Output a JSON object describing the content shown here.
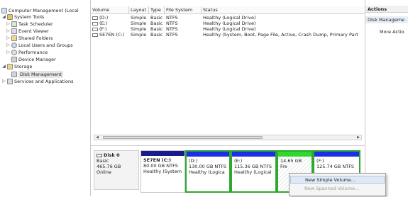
{
  "tree": {
    "items": [
      {
        "label": "Computer Management (Local",
        "toggle": "",
        "icon": "computer-icon"
      },
      {
        "label": "System Tools",
        "toggle": "◢",
        "icon": "tools-icon"
      },
      {
        "label": "Task Scheduler",
        "toggle": "▷",
        "icon": "clock-icon"
      },
      {
        "label": "Event Viewer",
        "toggle": "▷",
        "icon": "event-viewer-icon"
      },
      {
        "label": "Shared Folders",
        "toggle": "▷",
        "icon": "folder-icon"
      },
      {
        "label": "Local Users and Groups",
        "toggle": "▷",
        "icon": "users-icon"
      },
      {
        "label": "Performance",
        "toggle": "▷",
        "icon": "performance-icon"
      },
      {
        "label": "Device Manager",
        "toggle": "",
        "icon": "device-manager-icon"
      },
      {
        "label": "Storage",
        "toggle": "◢",
        "icon": "storage-icon"
      },
      {
        "label": "Disk Management",
        "toggle": "",
        "icon": "disk-management-icon"
      },
      {
        "label": "Services and Applications",
        "toggle": "▷",
        "icon": "services-icon"
      }
    ]
  },
  "volume_list": {
    "columns": [
      "Volume",
      "Layout",
      "Type",
      "File System",
      "Status"
    ],
    "rows": [
      {
        "volume": "(D:)",
        "layout": "Simple",
        "type": "Basic",
        "fs": "NTFS",
        "status": "Healthy (Logical Drive)"
      },
      {
        "volume": "(E:)",
        "layout": "Simple",
        "type": "Basic",
        "fs": "NTFS",
        "status": "Healthy (Logical Drive)"
      },
      {
        "volume": "(F:)",
        "layout": "Simple",
        "type": "Basic",
        "fs": "NTFS",
        "status": "Healthy (Logical Drive)"
      },
      {
        "volume": "SE7EN (C:)",
        "layout": "Simple",
        "type": "Basic",
        "fs": "NTFS",
        "status": "Healthy (System, Boot, Page File, Active, Crash Dump, Primary Part"
      }
    ]
  },
  "disk": {
    "name": "Disk 0",
    "type": "Basic",
    "size": "465.76 GB",
    "state": "Online",
    "partitions": [
      {
        "name": "SE7EN (C:)",
        "size": "80.00 GB NTFS",
        "status": "Healthy (System",
        "bar_color": "#1a1a8c"
      },
      {
        "name": "(D:)",
        "size": "130.00 GB NTFS",
        "status": "Healthy (Logica",
        "bar_color": "#1d2ee8"
      },
      {
        "name": "(E:)",
        "size": "115.36 GB NTFS",
        "status": "Healthy (Logical",
        "bar_color": "#1d2ee8"
      },
      {
        "name": "",
        "size": "14.65 GB",
        "status": "Fre",
        "bar_color": "#2ed82e"
      },
      {
        "name": "(F:)",
        "size": "125.74 GB NTFS",
        "status": "",
        "bar_color": "#1d2ee8"
      }
    ]
  },
  "actions": {
    "title": "Actions",
    "section": "Disk Manageme",
    "more": "More Actio"
  },
  "context_menu": {
    "items": [
      {
        "label": "New Simple Volume...",
        "enabled": true
      },
      {
        "label": "New Spanned Volume...",
        "enabled": false
      }
    ]
  },
  "colors": {
    "selection_green": "#2ea82e",
    "primary_partition_bar": "#1a1a8c",
    "logical_drive_bar": "#1d2ee8",
    "free_space_bar": "#2ed82e"
  }
}
